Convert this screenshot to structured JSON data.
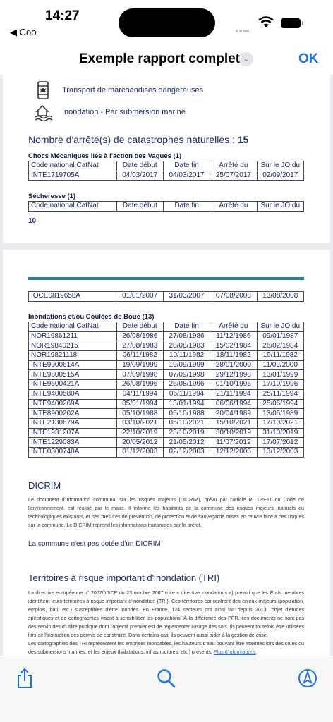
{
  "status": {
    "time": "14:27",
    "back_app": "◀ Coo"
  },
  "nav": {
    "title": "Exemple rapport complet",
    "chevron": "⌄",
    "ok": "OK"
  },
  "risks": [
    {
      "icon": "hazardous-goods-icon",
      "label": "Transport de marchandises dangereuses"
    },
    {
      "icon": "marine-flood-icon",
      "label": "Inondation - Par submersion marine"
    }
  ],
  "catnat": {
    "heading_prefix": "Nombre d'arrêté(s) de catastrophes naturelles : ",
    "heading_count": "15",
    "columns": [
      "Code national CatNat",
      "Date début",
      "Date fin",
      "Arrêté du",
      "Sur le JO du"
    ],
    "chocs": {
      "title": "Chocs Mécaniques liés à l'action des Vagues (1)",
      "rows": [
        [
          "INTE1719705A",
          "04/03/2017",
          "04/03/2017",
          "25/07/2017",
          "02/09/2017"
        ]
      ]
    },
    "secheresse": {
      "title": "Sécheresse (1)",
      "count": "10",
      "rows": [
        [
          "IOCE0819658A",
          "01/01/2007",
          "31/03/2007",
          "07/08/2008",
          "13/08/2008"
        ]
      ]
    },
    "inondations": {
      "title": "Inondations et/ou Coulées de Boue (13)",
      "rows": [
        [
          "NOR19861211",
          "26/08/1986",
          "27/08/1986",
          "11/12/1986",
          "09/01/1987"
        ],
        [
          "NOR19840215",
          "27/08/1983",
          "28/08/1983",
          "15/02/1984",
          "26/02/1984"
        ],
        [
          "NOR19821118",
          "06/11/1982",
          "10/11/1982",
          "18/11/1982",
          "19/11/1982"
        ],
        [
          "INTE9900614A",
          "19/09/1999",
          "19/09/1999",
          "28/01/2000",
          "11/02/2000"
        ],
        [
          "INTE9800515A",
          "07/09/1998",
          "07/09/1998",
          "29/12/1998",
          "13/01/1999"
        ],
        [
          "INTE9600421A",
          "26/08/1996",
          "26/08/1996",
          "01/10/1996",
          "17/10/1996"
        ],
        [
          "INTE9400580A",
          "04/11/1994",
          "06/11/1994",
          "21/11/1994",
          "25/11/1994"
        ],
        [
          "INTE9400269A",
          "05/01/1994",
          "13/01/1994",
          "06/06/1994",
          "25/06/1994"
        ],
        [
          "INTE8900202A",
          "05/10/1988",
          "05/10/1988",
          "20/04/1989",
          "13/05/1989"
        ],
        [
          "INTE2130679A",
          "03/10/2021",
          "05/10/2021",
          "15/10/2021",
          "17/10/2021"
        ],
        [
          "INTE1931207A",
          "22/10/2019",
          "23/10/2019",
          "30/10/2019",
          "31/10/2019"
        ],
        [
          "INTE1229083A",
          "20/05/2012",
          "21/05/2012",
          "11/07/2012",
          "17/07/2012"
        ],
        [
          "INTE0300740A",
          "01/12/2003",
          "02/12/2003",
          "12/12/2003",
          "13/12/2003"
        ]
      ]
    }
  },
  "dicrim": {
    "title": "DICRIM",
    "paragraph": "Le document d'information communal sur les risques majeurs (DICRIM), prévu par l'article R. 125-11 du Code de l'environnement, est réalisé par le maire. Il informe les habitants de la commune des risques majeurs, naturels ou technologiques existants, et des mesures de prévention, de protection et de sauvegarde mises en œuvre face à ces risques sur la commune. Le DICRIM reprend les informations transmises par le préfet.",
    "note": "La commune n'est pas dotée d'un DICRIM"
  },
  "tri": {
    "title": "Territoires à risque important d'inondation (TRI)",
    "paragraph": "La directive européenne n° 2007/60/CE du 23 octobre 2007 (dite « directive inondations ») prévoit que les États membres identifient leurs territoires à risque important d'inondation (TRI). Ces territoires concentrent des enjeux majeurs (population, emplois, bâti, etc.) susceptibles d'être inondés. En France, 124 secteurs ont ainsi fait depuis 2013 l'objet d'études spécifiques et de cartographies visant à sensibiliser les populations. À la différence des PPR, ces documents ne sont pas des servitudes d'utilité publique dont l'objectif premier est de réglementer l'usage des sols. Ils peuvent toutefois être utilisées lors de l'instruction des permis de construire. Dans certains cas, ils peuvent aussi aider à la gestion de crise.",
    "paragraph2": "Les cartographies des TRI représentent les emprises inondables, les hauteurs d'eau pouvant être atteintes lors des crues ou des submersions marines, et les enjeux (habitations, infrastructures, etc.) présents. ",
    "link": "Plus d'informations"
  },
  "toolbar": {
    "share": "share-icon",
    "search": "search-icon",
    "markup": "markup-icon"
  },
  "colors": {
    "accent": "#1a73e8",
    "heading": "#1b2a6b",
    "rule": "#2a7fa8"
  }
}
